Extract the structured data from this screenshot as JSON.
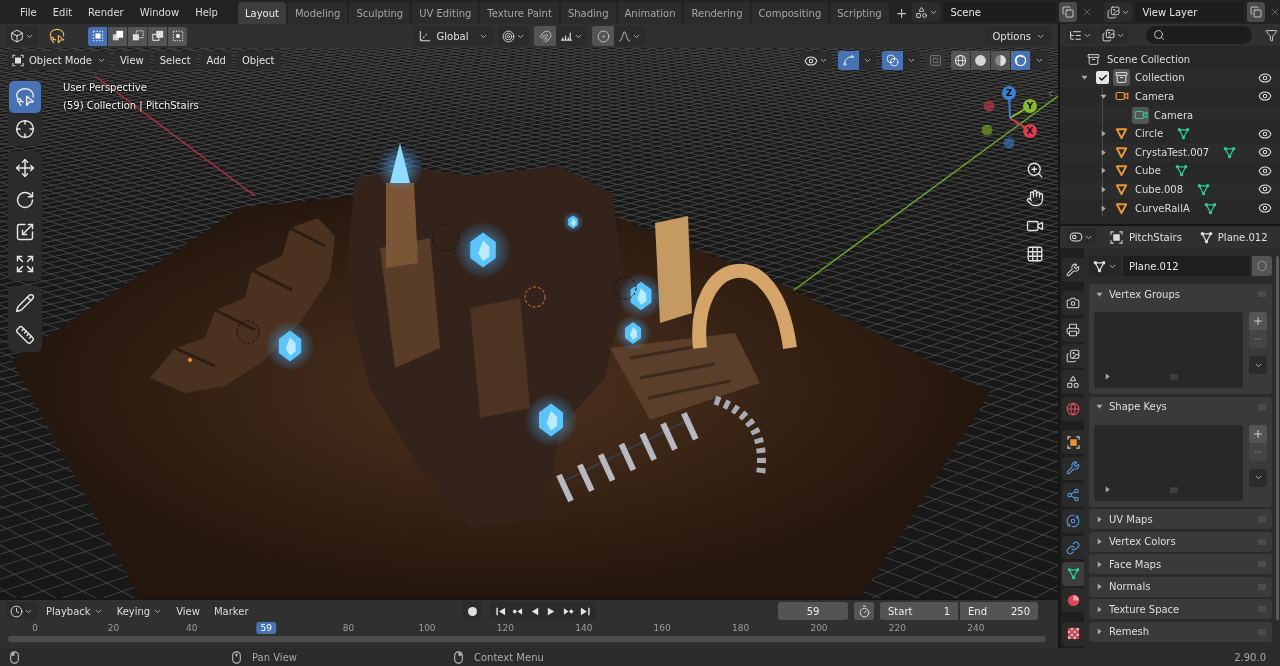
{
  "top_bar": {
    "menus": [
      "File",
      "Edit",
      "Render",
      "Window",
      "Help"
    ],
    "workspaces": [
      {
        "label": "Layout",
        "selected": true
      },
      {
        "label": "Modeling",
        "selected": false
      },
      {
        "label": "Sculpting",
        "selected": false
      },
      {
        "label": "UV Editing",
        "selected": false
      },
      {
        "label": "Texture Paint",
        "selected": false
      },
      {
        "label": "Shading",
        "selected": false
      },
      {
        "label": "Animation",
        "selected": false
      },
      {
        "label": "Rendering",
        "selected": false
      },
      {
        "label": "Compositing",
        "selected": false
      },
      {
        "label": "Scripting",
        "selected": false
      }
    ],
    "add_workspace": "+",
    "scene": "Scene",
    "view_layer": "View Layer"
  },
  "tool_header": {
    "select_modes": [
      {
        "kind": "set",
        "selected": true
      },
      {
        "kind": "extend",
        "selected": false
      },
      {
        "kind": "subtract",
        "selected": false
      },
      {
        "kind": "invert",
        "selected": false
      },
      {
        "kind": "intersect",
        "selected": false
      }
    ],
    "orientation": "Global",
    "snap": false,
    "proportional_editing": false,
    "options": "Options"
  },
  "viewport": {
    "mode": "Object Mode",
    "menus": [
      "View",
      "Select",
      "Add",
      "Object"
    ],
    "gizmos": true,
    "overlays": true,
    "xray": false,
    "shading": [
      {
        "kind": "wireframe",
        "selected": false
      },
      {
        "kind": "solid",
        "selected": false
      },
      {
        "kind": "material",
        "selected": false
      },
      {
        "kind": "rendered",
        "selected": true
      }
    ],
    "info": [
      "User Perspective",
      "(59) Collection | PitchStairs"
    ],
    "tool_groups": [
      {
        "tools": [
          {
            "kind": "select",
            "selected": true
          },
          {
            "kind": "cursor",
            "selected": false
          }
        ]
      },
      {
        "tools": [
          {
            "kind": "move",
            "selected": false
          },
          {
            "kind": "rotate",
            "selected": false
          },
          {
            "kind": "scale",
            "selected": false
          },
          {
            "kind": "transform",
            "selected": false
          }
        ]
      },
      {
        "tools": [
          {
            "kind": "annotate",
            "selected": false
          },
          {
            "kind": "measure",
            "selected": false
          }
        ]
      }
    ],
    "axes": [
      {
        "kind": "x",
        "label": "X",
        "color": "#e03a4e"
      },
      {
        "kind": "y",
        "label": "Y",
        "color": "#86b82c"
      },
      {
        "kind": "z",
        "label": "Z",
        "color": "#3b82d6"
      }
    ]
  },
  "outliner": {
    "tree": [
      {
        "label": "Scene Collection",
        "kind": "scene_collection",
        "active": false,
        "children": [
          {
            "label": "Collection",
            "kind": "collection",
            "expanded": true,
            "checked": true,
            "active": true,
            "visible": true,
            "children": [
              {
                "label": "Camera",
                "kind": "camera",
                "expanded": true,
                "active": false,
                "visible": true,
                "children": [
                  {
                    "label": "Camera",
                    "kind": "camera_data",
                    "active": true
                  }
                ]
              },
              {
                "label": "Circle",
                "kind": "mesh",
                "expanded": false,
                "active": false,
                "visible": true
              },
              {
                "label": "CrystaTest.007",
                "kind": "mesh",
                "expanded": false,
                "active": false,
                "visible": true
              },
              {
                "label": "Cube",
                "kind": "mesh",
                "expanded": false,
                "active": false,
                "visible": true
              },
              {
                "label": "Cube.008",
                "kind": "mesh",
                "expanded": false,
                "active": false,
                "visible": true
              },
              {
                "label": "CurveRailA",
                "kind": "mesh",
                "expanded": false,
                "active": false,
                "visible": true
              }
            ]
          }
        ]
      }
    ]
  },
  "properties": {
    "object": "PitchStairs",
    "data": "Plane.012",
    "tabs": [
      {
        "kind": "tool",
        "selected": false
      },
      {
        "kind": "render",
        "selected": false
      },
      {
        "kind": "output",
        "selected": false
      },
      {
        "kind": "view_layer",
        "selected": false
      },
      {
        "kind": "scene",
        "selected": false
      },
      {
        "kind": "world",
        "selected": false
      },
      {
        "kind": "object",
        "selected": false
      },
      {
        "kind": "modifiers",
        "selected": false
      },
      {
        "kind": "particles",
        "selected": false
      },
      {
        "kind": "physics",
        "selected": false
      },
      {
        "kind": "constraints",
        "selected": false
      },
      {
        "kind": "data",
        "selected": true
      },
      {
        "kind": "material",
        "selected": false
      },
      {
        "kind": "texture",
        "selected": false
      }
    ],
    "mesh": "Plane.012",
    "panels": [
      {
        "title": "Vertex Groups",
        "expanded": true,
        "can_remove": false
      },
      {
        "title": "Shape Keys",
        "expanded": true,
        "can_remove": false
      },
      {
        "title": "UV Maps",
        "expanded": false
      },
      {
        "title": "Vertex Colors",
        "expanded": false
      },
      {
        "title": "Face Maps",
        "expanded": false
      },
      {
        "title": "Normals",
        "expanded": false
      },
      {
        "title": "Texture Space",
        "expanded": false
      },
      {
        "title": "Remesh",
        "expanded": false
      }
    ]
  },
  "timeline": {
    "menus": [
      {
        "label": "Playback",
        "dropdown": true
      },
      {
        "label": "Keying",
        "dropdown": true
      },
      {
        "label": "View",
        "dropdown": false
      },
      {
        "label": "Marker",
        "dropdown": false
      }
    ],
    "auto_keying": false,
    "current_frame": "59",
    "preview_range": false,
    "start_label": "Start",
    "start": "1",
    "end_label": "End",
    "end": "250",
    "ruler": [
      {
        "kind": "tick",
        "label": "0"
      },
      {
        "kind": "tick",
        "label": "20"
      },
      {
        "kind": "tick",
        "label": "40"
      },
      {
        "kind": "playhead",
        "label": "59"
      },
      {
        "kind": "tick",
        "label": "80"
      },
      {
        "kind": "tick",
        "label": "100"
      },
      {
        "kind": "tick",
        "label": "120"
      },
      {
        "kind": "tick",
        "label": "140"
      },
      {
        "kind": "tick",
        "label": "160"
      },
      {
        "kind": "tick",
        "label": "180"
      },
      {
        "kind": "tick",
        "label": "200"
      },
      {
        "kind": "tick",
        "label": "220"
      },
      {
        "kind": "tick",
        "label": "240"
      }
    ]
  },
  "status_bar": {
    "hints": [
      {
        "kind": "left"
      },
      {
        "kind": "middle",
        "label": "Pan View"
      },
      {
        "kind": "right",
        "label": "Context Menu"
      }
    ],
    "version": "2.90.0"
  }
}
